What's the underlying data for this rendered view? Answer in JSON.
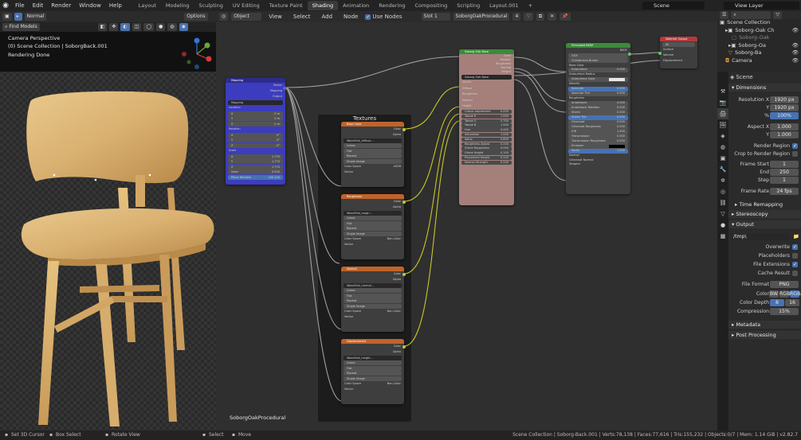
{
  "menu": {
    "items": [
      "File",
      "Edit",
      "Render",
      "Window",
      "Help"
    ],
    "workspaces": [
      "Layout",
      "Modeling",
      "Sculpting",
      "UV Editing",
      "Texture Paint",
      "Shading",
      "Animation",
      "Rendering",
      "Compositing",
      "Scripting",
      "Layout.001",
      "+"
    ],
    "active_workspace": "Shading",
    "scene": "Scene",
    "view_layer": "View Layer"
  },
  "viewport": {
    "mode": "Normal",
    "options": "Options",
    "find_models": "Find Models",
    "camera_label": "Camera Perspective",
    "collection_label": "(0) Scene Collection | SoborgBack.001",
    "render_status": "Rendering Done"
  },
  "node_editor": {
    "editor_mode": "Object",
    "menu": [
      "View",
      "Select",
      "Add",
      "Node"
    ],
    "use_nodes": "Use Nodes",
    "slot": "Slot 1",
    "material": "SoborgOakProcedural",
    "users": "4",
    "tree_name": "SoborgOakProcedural",
    "frame_label": "Textures",
    "mapping": {
      "title": "Mapping",
      "outputs": [
        "Vector"
      ],
      "inputs": [
        "Mapping",
        "Output"
      ],
      "selector": "Mapping",
      "location_label": "Location",
      "location": [
        "0 m",
        "0 m",
        "0 m"
      ],
      "rotation_label": "Rotation",
      "rotation": [
        "0°",
        "0°",
        "0°"
      ],
      "scale_label": "Scale",
      "scale": [
        "1.770",
        "1.770",
        "1.770"
      ],
      "extra": [
        [
          "Seed",
          "0.000"
        ],
        [
          "Plane Random",
          "245.100"
        ]
      ]
    },
    "textures": [
      {
        "title": "Base Color",
        "file": "WoodOak_diffuse...",
        "colorspace": "sRGB"
      },
      {
        "title": "Roughness",
        "file": "WoodOak_rough...",
        "colorspace": "Non-Color"
      },
      {
        "title": "Normal",
        "file": "WoodOak_normal...",
        "colorspace": "Non-Color"
      },
      {
        "title": "Displacement",
        "file": "WoodOak_height...",
        "colorspace": "Non-Color"
      }
    ],
    "texture_rows": {
      "outputs": [
        "Color",
        "Alpha"
      ],
      "interp": "Linear",
      "proj": "Flat",
      "ext": "Repeat",
      "src": "Single Image",
      "colorspace_label": "Color Space",
      "vector": "Vector"
    },
    "group": {
      "title": "Soborg Oak Base",
      "outputs": [
        "Color",
        "Metallic",
        "Roughness",
        "Normal",
        "Height"
      ],
      "group_name": "Soborg Oak Base",
      "inputs": [
        "Vector",
        "Diffuse",
        "Roughness",
        "Normal",
        "Height"
      ],
      "params": [
        [
          "Colour Adjustment",
          "0.000"
        ],
        [
          "Tweak R",
          "1.000"
        ],
        [
          "Tweak G",
          "0.700"
        ],
        [
          "Tweak B",
          "1.000"
        ],
        [
          "Hue",
          "0.000"
        ],
        [
          "Saturation",
          "1.000"
        ],
        [
          "Value",
          "0.800"
        ],
        [
          "Roughness Adjust",
          "0.200"
        ],
        [
          "Grime Roughness",
          "0.000"
        ],
        [
          "Grime Height",
          "0.100"
        ],
        [
          "Procedural Height",
          "0.200"
        ],
        [
          "Normal Strength",
          "0.200"
        ]
      ]
    },
    "bsdf": {
      "title": "Principled BSDF",
      "output": "BSDF",
      "distribution": "GGX",
      "subsurface_method": "Christensen-Burley",
      "rows": [
        [
          "Base Color",
          ""
        ],
        [
          "Subsurface",
          "0.000"
        ],
        [
          "Subsurface Radius",
          ""
        ],
        [
          "Subsurface Color",
          ""
        ],
        [
          "Metallic",
          ""
        ],
        [
          "Specular",
          "0.500"
        ],
        [
          "Specular Tint",
          "0.000"
        ],
        [
          "Roughness",
          ""
        ],
        [
          "Anisotropic",
          "0.000"
        ],
        [
          "Anisotropic Rotation",
          "0.000"
        ],
        [
          "Sheen",
          "0.000"
        ],
        [
          "Sheen Tint",
          "0.500"
        ],
        [
          "Clearcoat",
          "0.000"
        ],
        [
          "Clearcoat Roughness",
          "0.030"
        ],
        [
          "IOR",
          "1.450"
        ],
        [
          "Transmission",
          "0.000"
        ],
        [
          "Transmission Roughness",
          "0.000"
        ],
        [
          "Emission",
          ""
        ],
        [
          "Alpha",
          "1.000"
        ],
        [
          "Normal",
          ""
        ],
        [
          "Clearcoat Normal",
          ""
        ],
        [
          "Tangent",
          ""
        ]
      ]
    },
    "output_node": {
      "title": "Material Output",
      "target": "All",
      "inputs": [
        "Surface",
        "Volume",
        "Displacement"
      ]
    }
  },
  "outliner": {
    "title": "Scene Collection",
    "items": [
      "Soborg-Oak Ch",
      "Soborg-Oak",
      "Soborg-Oa",
      "Soborg-Ba",
      "Camera"
    ]
  },
  "properties": {
    "scene_name": "Scene",
    "dimensions_section": "Dimensions",
    "res_x_label": "Resolution X",
    "res_x": "1920 px",
    "res_y_label": "Y",
    "res_y": "1920 px",
    "percent_label": "%",
    "percent": "100%",
    "aspect_x_label": "Aspect X",
    "aspect_x": "1.000",
    "aspect_y_label": "Y",
    "aspect_y": "1.000",
    "render_region": "Render Region",
    "crop_region": "Crop to Render Region",
    "frame_start_label": "Frame Start",
    "frame_start": "1",
    "end_label": "End",
    "end": "250",
    "step_label": "Step",
    "step": "1",
    "frame_rate_label": "Frame Rate",
    "frame_rate": "24 fps",
    "time_remapping": "Time Remapping",
    "stereoscopy": "Stereoscopy",
    "output_section": "Output",
    "output_path": "/tmp\\",
    "overwrite": "Overwrite",
    "placeholders": "Placeholders",
    "file_extensions": "File Extensions",
    "cache_result": "Cache Result",
    "file_format_label": "File Format",
    "file_format": "PNG",
    "color_label": "Color",
    "color_opts": [
      "BW",
      "RGB",
      "RGBA"
    ],
    "color_depth_label": "Color Depth",
    "color_depth": [
      "8",
      "16"
    ],
    "compression_label": "Compression",
    "compression": "15%",
    "metadata_section": "Metadata",
    "post_section": "Post Processing"
  },
  "status": {
    "left": [
      "Set 3D Cursor",
      "Box Select",
      "Rotate View",
      "Select",
      "Move"
    ],
    "right": "Scene Collection | Soborg-Back.001 | Verts:78,138 | Faces:77,616 | Tris:155,232 | Objects:0/7 | Mem: 1.14 GiB | v2.82.7"
  },
  "colors": {
    "accent": "#4772b3",
    "mapping_header": "#3b3bc7",
    "texture_header": "#c0632a",
    "group_header": "#3a8b3a",
    "bsdf_header": "#3a8b3a",
    "output_header": "#b33a3a",
    "group_body": "#a57f7a"
  }
}
